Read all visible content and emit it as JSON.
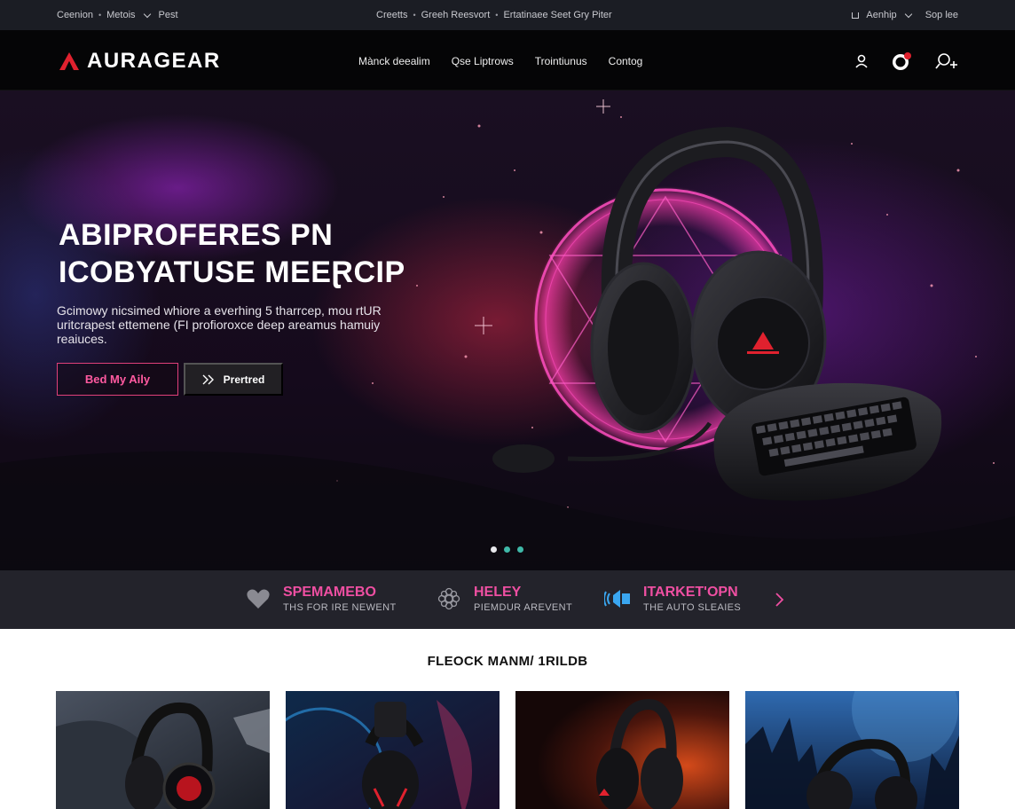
{
  "utility": {
    "left": [
      "Ceenion",
      "Metois"
    ],
    "left_post": "Pest",
    "center": [
      "Creetts",
      "Greeh Reesvort",
      "Ertatinaee Seet Gry Piter"
    ],
    "right_label": "Aenhip",
    "right_extra": "Sop lee"
  },
  "nav": {
    "brand": "AURAGEAR",
    "links": [
      "Mànck deealim",
      "Qse Liptrows",
      "Trointiunus",
      "Contog"
    ],
    "icons": [
      "user-icon",
      "avatar-badge-icon",
      "search-plus-icon"
    ]
  },
  "hero": {
    "title_line1": "ABIPROFERES PN",
    "title_line2": "ICOBYATUSE MEEⱤCIP",
    "description": "Gcimowy nicsimed whiore a everhing 5 tharrcep, mou rtUR uritcrapest ettemene (FI profioroxce deep areamus hamuiy reaiuces.",
    "primary_button": "Bed My Aily",
    "secondary_button": "Prertred",
    "slides": 3,
    "active_slide": 0
  },
  "features": [
    {
      "icon": "heart-icon",
      "title": "SPEMAMEBO",
      "subtitle": "THS FOR IRE NEWENT"
    },
    {
      "icon": "gear-flower-icon",
      "title": "HELEY",
      "subtitle": "PIEMDUR AREVENT"
    },
    {
      "icon": "speaker-icon",
      "title": "ITARKET'OPN",
      "subtitle": "THE AUTO SLEAIES"
    }
  ],
  "products": {
    "title": "FLEOCK MANM/ 1RILDB",
    "cards": [
      "product-card-1",
      "product-card-2",
      "product-card-3",
      "product-card-4"
    ]
  },
  "colors": {
    "accent_pink": "#ef4fa2",
    "brand_red": "#e0212e",
    "dark_bg": "#050506",
    "teal_dot": "#3fb8a8"
  }
}
